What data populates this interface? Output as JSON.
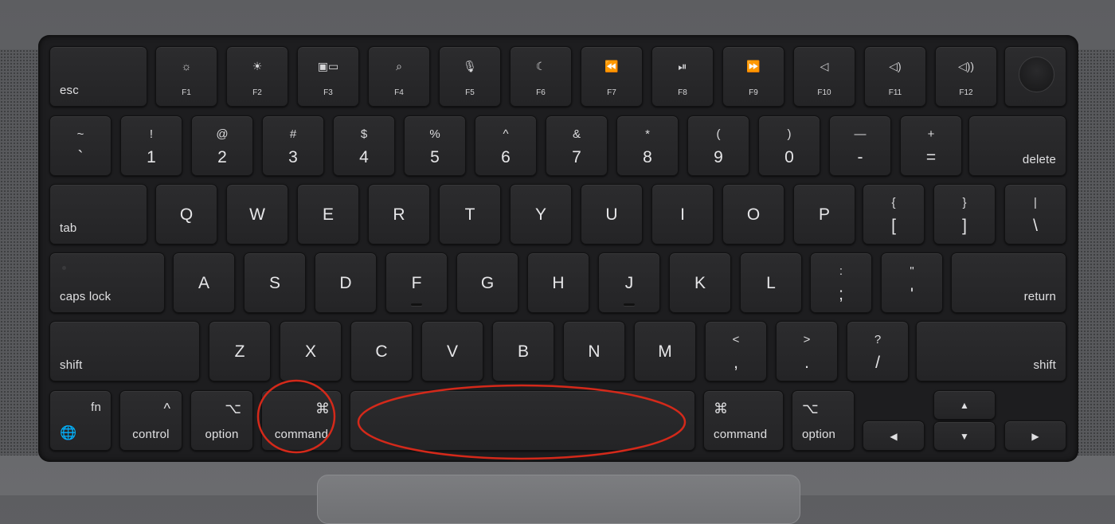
{
  "function_row": [
    {
      "icon": "brightness-down-icon",
      "glyph": "☼",
      "label": "F1"
    },
    {
      "icon": "brightness-up-icon",
      "glyph": "☀",
      "label": "F2"
    },
    {
      "icon": "mission-control-icon",
      "glyph": "▣▭",
      "label": "F3"
    },
    {
      "icon": "search-icon",
      "glyph": "⌕",
      "label": "F4"
    },
    {
      "icon": "microphone-icon",
      "glyph": "🎙",
      "label": "F5"
    },
    {
      "icon": "moon-icon",
      "glyph": "☾",
      "label": "F6"
    },
    {
      "icon": "rewind-icon",
      "glyph": "⏪",
      "label": "F7"
    },
    {
      "icon": "play-pause-icon",
      "glyph": "⏯",
      "label": "F8"
    },
    {
      "icon": "fast-forward-icon",
      "glyph": "⏩",
      "label": "F9"
    },
    {
      "icon": "volume-mute-icon",
      "glyph": "◁",
      "label": "F10"
    },
    {
      "icon": "volume-down-icon",
      "glyph": "◁)",
      "label": "F11"
    },
    {
      "icon": "volume-up-icon",
      "glyph": "◁))",
      "label": "F12"
    }
  ],
  "keys": {
    "esc": "esc",
    "delete": "delete",
    "tab": "tab",
    "caps_lock": "caps lock",
    "return": "return",
    "shift_left": "shift",
    "shift_right": "shift",
    "fn": "fn",
    "control": "control",
    "option_left": "option",
    "command_left": "command",
    "command_right": "command",
    "option_right": "option",
    "control_symbol": "^",
    "option_symbol": "⌥",
    "command_symbol": "⌘",
    "globe_symbol": "🌐"
  },
  "number_row": [
    {
      "upper": "~",
      "lower": "`"
    },
    {
      "upper": "!",
      "lower": "1"
    },
    {
      "upper": "@",
      "lower": "2"
    },
    {
      "upper": "#",
      "lower": "3"
    },
    {
      "upper": "$",
      "lower": "4"
    },
    {
      "upper": "%",
      "lower": "5"
    },
    {
      "upper": "^",
      "lower": "6"
    },
    {
      "upper": "&",
      "lower": "7"
    },
    {
      "upper": "*",
      "lower": "8"
    },
    {
      "upper": "(",
      "lower": "9"
    },
    {
      "upper": ")",
      "lower": "0"
    },
    {
      "upper": "—",
      "lower": "-"
    },
    {
      "upper": "+",
      "lower": "="
    }
  ],
  "qwerty_row": [
    "Q",
    "W",
    "E",
    "R",
    "T",
    "Y",
    "U",
    "I",
    "O",
    "P"
  ],
  "qwerty_punct": [
    {
      "upper": "{",
      "lower": "["
    },
    {
      "upper": "}",
      "lower": "]"
    },
    {
      "upper": "|",
      "lower": "\\"
    }
  ],
  "home_row": [
    "A",
    "S",
    "D",
    "F",
    "G",
    "H",
    "J",
    "K",
    "L"
  ],
  "home_punct": [
    {
      "upper": ":",
      "lower": ";"
    },
    {
      "upper": "\"",
      "lower": "'"
    }
  ],
  "bottom_letter_row": [
    "Z",
    "X",
    "C",
    "V",
    "B",
    "N",
    "M"
  ],
  "bottom_punct": [
    {
      "upper": "<",
      "lower": ","
    },
    {
      "upper": ">",
      "lower": "."
    },
    {
      "upper": "?",
      "lower": "/"
    }
  ],
  "arrows": {
    "up": "▲",
    "down": "▼",
    "left": "◀",
    "right": "▶"
  },
  "annotations": {
    "color": "#d4291a",
    "highlighted": [
      "command_left",
      "spacebar"
    ]
  }
}
